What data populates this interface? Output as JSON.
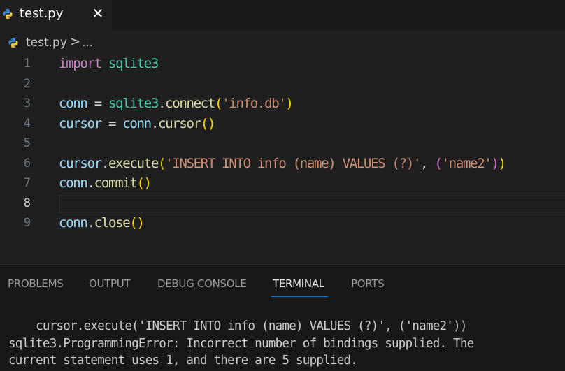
{
  "tab": {
    "icon": "python-icon",
    "label": "test.py",
    "close_glyph": "✕"
  },
  "breadcrumb": {
    "file": "test.py",
    "separator": ">",
    "more": "..."
  },
  "editor": {
    "current_line": 8,
    "lines": [
      {
        "n": "1",
        "text": "import sqlite3"
      },
      {
        "n": "2",
        "text": ""
      },
      {
        "n": "3",
        "text": "conn = sqlite3.connect('info.db')"
      },
      {
        "n": "4",
        "text": "cursor = conn.cursor()"
      },
      {
        "n": "5",
        "text": ""
      },
      {
        "n": "6",
        "text": "cursor.execute('INSERT INTO info (name) VALUES (?)', ('name2'))"
      },
      {
        "n": "7",
        "text": "conn.commit()"
      },
      {
        "n": "8",
        "text": ""
      },
      {
        "n": "9",
        "text": "conn.close()"
      }
    ]
  },
  "panel": {
    "tabs": [
      "PROBLEMS",
      "OUTPUT",
      "DEBUG CONSOLE",
      "TERMINAL",
      "PORTS"
    ],
    "active_tab": "TERMINAL",
    "terminal_lines": [
      "    cursor.execute('INSERT INTO info (name) VALUES (?)', ('name2'))",
      "sqlite3.ProgrammingError: Incorrect number of bindings supplied. The",
      "current statement uses 1, and there are 5 supplied."
    ]
  },
  "colors": {
    "editor_bg": "#1f1f1f",
    "tabbar_bg": "#181818",
    "panel_bg": "#181818",
    "active_tab_underline": "#0078d4",
    "keyword_import": "#c586c0",
    "module": "#4ec9b0",
    "variable": "#9cdcfe",
    "function": "#dcdcaa",
    "string": "#ce9178",
    "bracket_level1": "#ffd700",
    "bracket_level2": "#da70d6"
  }
}
